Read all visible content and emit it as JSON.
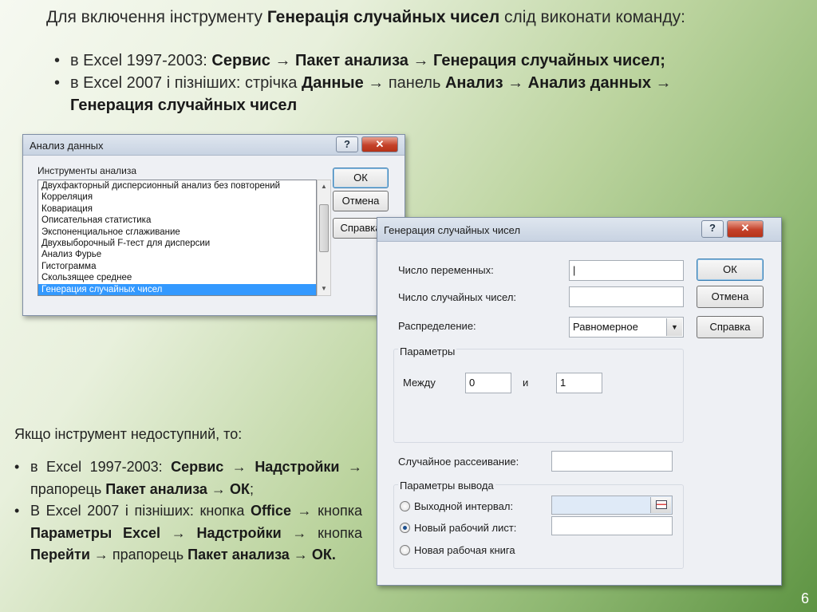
{
  "intro": {
    "pre": "Для включення інструменту ",
    "bold": "Генерація случайных чисел",
    "post": " слід виконати команду:"
  },
  "bullets": [
    {
      "pre": "в Excel 1997-2003: ",
      "b1": "Сервис",
      "a1": " → ",
      "b2": "Пакет анализа",
      "a2": " → ",
      "b3": "Генерация случайных чисел;"
    },
    {
      "pre": "в Excel 2007 і пізніших: стрічка ",
      "b1": "Данные",
      "a1": " → панель ",
      "b2": "Анализ",
      "a2": " → ",
      "b3": "Анализ данных",
      "a3": " →",
      "b4": "Генерация случайных чисел"
    }
  ],
  "dialog1": {
    "title": "Анализ данных",
    "help": "?",
    "close": "✕",
    "group_label": "Инструменты анализа",
    "items": [
      "Двухфакторный дисперсионный анализ без повторений",
      "Корреляция",
      "Ковариация",
      "Описательная статистика",
      "Экспоненциальное сглаживание",
      "Двухвыборочный F-тест для дисперсии",
      "Анализ Фурье",
      "Гистограмма",
      "Скользящее среднее",
      "Генерация случайных чисел"
    ],
    "selected_index": 9,
    "ok": "ОК",
    "cancel": "Отмена",
    "help_btn": "Справка"
  },
  "dialog2": {
    "title": "Генерация случайных чисел",
    "help": "?",
    "close": "✕",
    "num_vars_label": "Число переменных:",
    "num_vars_value": "|",
    "num_randoms_label": "Число случайных чисел:",
    "num_randoms_value": "",
    "distribution_label": "Распределение:",
    "distribution_value": "Равномерное",
    "params_label": "Параметры",
    "between_label": "Между",
    "between_from": "0",
    "and_label": "и",
    "between_to": "1",
    "seed_label": "Случайное рассеивание:",
    "seed_value": "",
    "output_label": "Параметры вывода",
    "out_range_label": "Выходной интервал:",
    "out_range_value": "",
    "new_sheet_label": "Новый рабочий лист:",
    "new_sheet_value": "",
    "new_book_label": "Новая рабочая книга",
    "selected_output": "new_sheet",
    "ok": "ОК",
    "cancel": "Отмена",
    "help_btn": "Справка"
  },
  "note": "Якщо інструмент недоступний, то:",
  "bullets2": [
    {
      "pre": "в Excel 1997-2003: ",
      "b1": "Сервис",
      "a1": " → ",
      "b2": "Надстройки",
      "a2": " → прапорець ",
      "b3": "Пакет анализа",
      "a3": " → ",
      "b4": "ОК",
      "a4": ";"
    },
    {
      "pre": "В Excel 2007 і пізніших: кнопка ",
      "b1": "Office",
      "a1": " → кнопка ",
      "b2": "Параметры Excel",
      "a2": " → ",
      "b3": "Надстройки",
      "a3": " → кнопка ",
      "b4": "Перейти",
      "a4": " → прапорець ",
      "b5": "Пакет анализа",
      "a5": " → ",
      "b6": "ОК."
    }
  ],
  "page_number": "6",
  "colors": {
    "selection": "#3399ff",
    "close_button": "#c4412a"
  }
}
